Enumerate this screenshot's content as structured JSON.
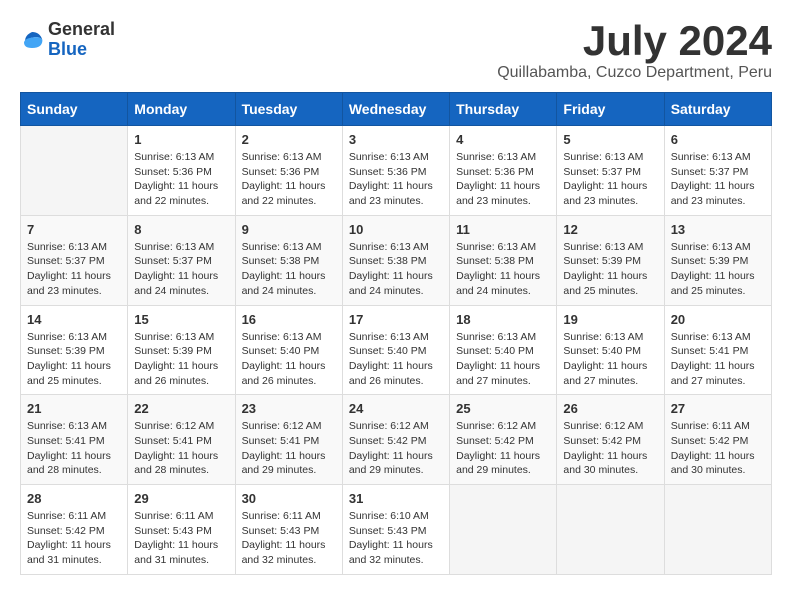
{
  "logo": {
    "general": "General",
    "blue": "Blue"
  },
  "title": "July 2024",
  "location": "Quillabamba, Cuzco Department, Peru",
  "days_header": [
    "Sunday",
    "Monday",
    "Tuesday",
    "Wednesday",
    "Thursday",
    "Friday",
    "Saturday"
  ],
  "weeks": [
    [
      {
        "day": "",
        "info": ""
      },
      {
        "day": "1",
        "info": "Sunrise: 6:13 AM\nSunset: 5:36 PM\nDaylight: 11 hours\nand 22 minutes."
      },
      {
        "day": "2",
        "info": "Sunrise: 6:13 AM\nSunset: 5:36 PM\nDaylight: 11 hours\nand 22 minutes."
      },
      {
        "day": "3",
        "info": "Sunrise: 6:13 AM\nSunset: 5:36 PM\nDaylight: 11 hours\nand 23 minutes."
      },
      {
        "day": "4",
        "info": "Sunrise: 6:13 AM\nSunset: 5:36 PM\nDaylight: 11 hours\nand 23 minutes."
      },
      {
        "day": "5",
        "info": "Sunrise: 6:13 AM\nSunset: 5:37 PM\nDaylight: 11 hours\nand 23 minutes."
      },
      {
        "day": "6",
        "info": "Sunrise: 6:13 AM\nSunset: 5:37 PM\nDaylight: 11 hours\nand 23 minutes."
      }
    ],
    [
      {
        "day": "7",
        "info": "Sunrise: 6:13 AM\nSunset: 5:37 PM\nDaylight: 11 hours\nand 23 minutes."
      },
      {
        "day": "8",
        "info": "Sunrise: 6:13 AM\nSunset: 5:37 PM\nDaylight: 11 hours\nand 24 minutes."
      },
      {
        "day": "9",
        "info": "Sunrise: 6:13 AM\nSunset: 5:38 PM\nDaylight: 11 hours\nand 24 minutes."
      },
      {
        "day": "10",
        "info": "Sunrise: 6:13 AM\nSunset: 5:38 PM\nDaylight: 11 hours\nand 24 minutes."
      },
      {
        "day": "11",
        "info": "Sunrise: 6:13 AM\nSunset: 5:38 PM\nDaylight: 11 hours\nand 24 minutes."
      },
      {
        "day": "12",
        "info": "Sunrise: 6:13 AM\nSunset: 5:39 PM\nDaylight: 11 hours\nand 25 minutes."
      },
      {
        "day": "13",
        "info": "Sunrise: 6:13 AM\nSunset: 5:39 PM\nDaylight: 11 hours\nand 25 minutes."
      }
    ],
    [
      {
        "day": "14",
        "info": "Sunrise: 6:13 AM\nSunset: 5:39 PM\nDaylight: 11 hours\nand 25 minutes."
      },
      {
        "day": "15",
        "info": "Sunrise: 6:13 AM\nSunset: 5:39 PM\nDaylight: 11 hours\nand 26 minutes."
      },
      {
        "day": "16",
        "info": "Sunrise: 6:13 AM\nSunset: 5:40 PM\nDaylight: 11 hours\nand 26 minutes."
      },
      {
        "day": "17",
        "info": "Sunrise: 6:13 AM\nSunset: 5:40 PM\nDaylight: 11 hours\nand 26 minutes."
      },
      {
        "day": "18",
        "info": "Sunrise: 6:13 AM\nSunset: 5:40 PM\nDaylight: 11 hours\nand 27 minutes."
      },
      {
        "day": "19",
        "info": "Sunrise: 6:13 AM\nSunset: 5:40 PM\nDaylight: 11 hours\nand 27 minutes."
      },
      {
        "day": "20",
        "info": "Sunrise: 6:13 AM\nSunset: 5:41 PM\nDaylight: 11 hours\nand 27 minutes."
      }
    ],
    [
      {
        "day": "21",
        "info": "Sunrise: 6:13 AM\nSunset: 5:41 PM\nDaylight: 11 hours\nand 28 minutes."
      },
      {
        "day": "22",
        "info": "Sunrise: 6:12 AM\nSunset: 5:41 PM\nDaylight: 11 hours\nand 28 minutes."
      },
      {
        "day": "23",
        "info": "Sunrise: 6:12 AM\nSunset: 5:41 PM\nDaylight: 11 hours\nand 29 minutes."
      },
      {
        "day": "24",
        "info": "Sunrise: 6:12 AM\nSunset: 5:42 PM\nDaylight: 11 hours\nand 29 minutes."
      },
      {
        "day": "25",
        "info": "Sunrise: 6:12 AM\nSunset: 5:42 PM\nDaylight: 11 hours\nand 29 minutes."
      },
      {
        "day": "26",
        "info": "Sunrise: 6:12 AM\nSunset: 5:42 PM\nDaylight: 11 hours\nand 30 minutes."
      },
      {
        "day": "27",
        "info": "Sunrise: 6:11 AM\nSunset: 5:42 PM\nDaylight: 11 hours\nand 30 minutes."
      }
    ],
    [
      {
        "day": "28",
        "info": "Sunrise: 6:11 AM\nSunset: 5:42 PM\nDaylight: 11 hours\nand 31 minutes."
      },
      {
        "day": "29",
        "info": "Sunrise: 6:11 AM\nSunset: 5:43 PM\nDaylight: 11 hours\nand 31 minutes."
      },
      {
        "day": "30",
        "info": "Sunrise: 6:11 AM\nSunset: 5:43 PM\nDaylight: 11 hours\nand 32 minutes."
      },
      {
        "day": "31",
        "info": "Sunrise: 6:10 AM\nSunset: 5:43 PM\nDaylight: 11 hours\nand 32 minutes."
      },
      {
        "day": "",
        "info": ""
      },
      {
        "day": "",
        "info": ""
      },
      {
        "day": "",
        "info": ""
      }
    ]
  ]
}
